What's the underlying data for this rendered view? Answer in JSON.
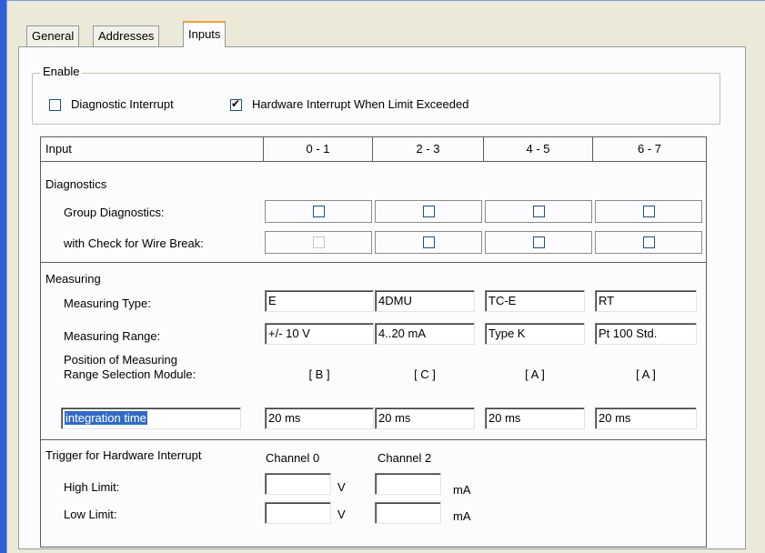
{
  "tabs": [
    {
      "label": "General"
    },
    {
      "label": "Addresses"
    },
    {
      "label": "Inputs"
    }
  ],
  "enable": {
    "title": "Enable",
    "diagnostic_interrupt": {
      "label": "Diagnostic Interrupt",
      "checked": false
    },
    "hardware_interrupt": {
      "label": "Hardware Interrupt When Limit Exceeded",
      "checked": true
    }
  },
  "table": {
    "input_header": "Input",
    "columns": [
      "0 - 1",
      "2 - 3",
      "4 - 5",
      "6 - 7"
    ],
    "diagnostics": {
      "title": "Diagnostics",
      "group_label": "Group Diagnostics:",
      "wire_label": "with Check for Wire Break:",
      "group_checked": [
        false,
        false,
        false,
        false
      ],
      "wire_checked": [
        false,
        false,
        false,
        false
      ],
      "wire_disabled": [
        true,
        false,
        false,
        false
      ]
    },
    "measuring": {
      "title": "Measuring",
      "type_label": "Measuring Type:",
      "types": [
        "E",
        "4DMU",
        "TC-E",
        "RT"
      ],
      "range_label": "Measuring Range:",
      "ranges": [
        "+/- 10 V",
        "4..20 mA",
        "Type K",
        "Pt 100 Std."
      ],
      "position_label_1": "Position of Measuring",
      "position_label_2": "Range Selection Module:",
      "positions": [
        "[ B ]",
        "[ C ]",
        "[ A ]",
        "[ A ]"
      ],
      "integration_label": "integration time",
      "integration": [
        "20 ms",
        "20 ms",
        "20 ms",
        "20 ms"
      ]
    },
    "trigger": {
      "title": "Trigger for Hardware Interrupt",
      "channel0": "Channel 0",
      "channel2": "Channel 2",
      "high_label": "High Limit:",
      "low_label": "Low Limit:",
      "high_ch0": "",
      "high_ch2": "",
      "low_ch0": "",
      "low_ch2": "",
      "unit_ch0": "V",
      "unit_ch2": "mA"
    }
  }
}
